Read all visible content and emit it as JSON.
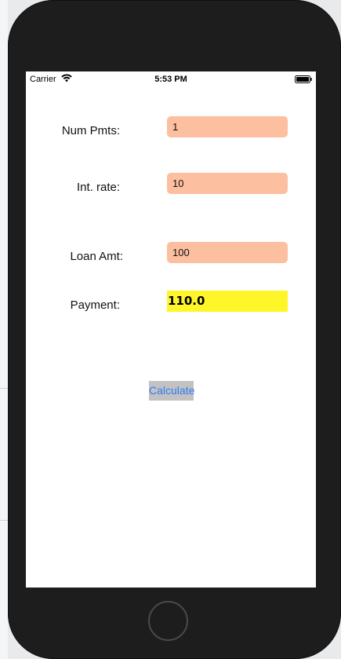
{
  "status_bar": {
    "carrier": "Carrier",
    "time": "5:53 PM"
  },
  "form": {
    "num_pmts": {
      "label": "Num Pmts:",
      "value": "1"
    },
    "int_rate": {
      "label": "Int. rate:",
      "value": "10"
    },
    "loan_amt": {
      "label": "Loan Amt:",
      "value": "100"
    },
    "payment": {
      "label": "Payment:",
      "value": "110.0"
    }
  },
  "actions": {
    "calculate_label": "Calculate"
  },
  "colors": {
    "input_bg": "#fcbf9f",
    "result_bg": "#fff62a",
    "button_bg": "#c2c2c2",
    "button_text": "#2d7cf6"
  }
}
